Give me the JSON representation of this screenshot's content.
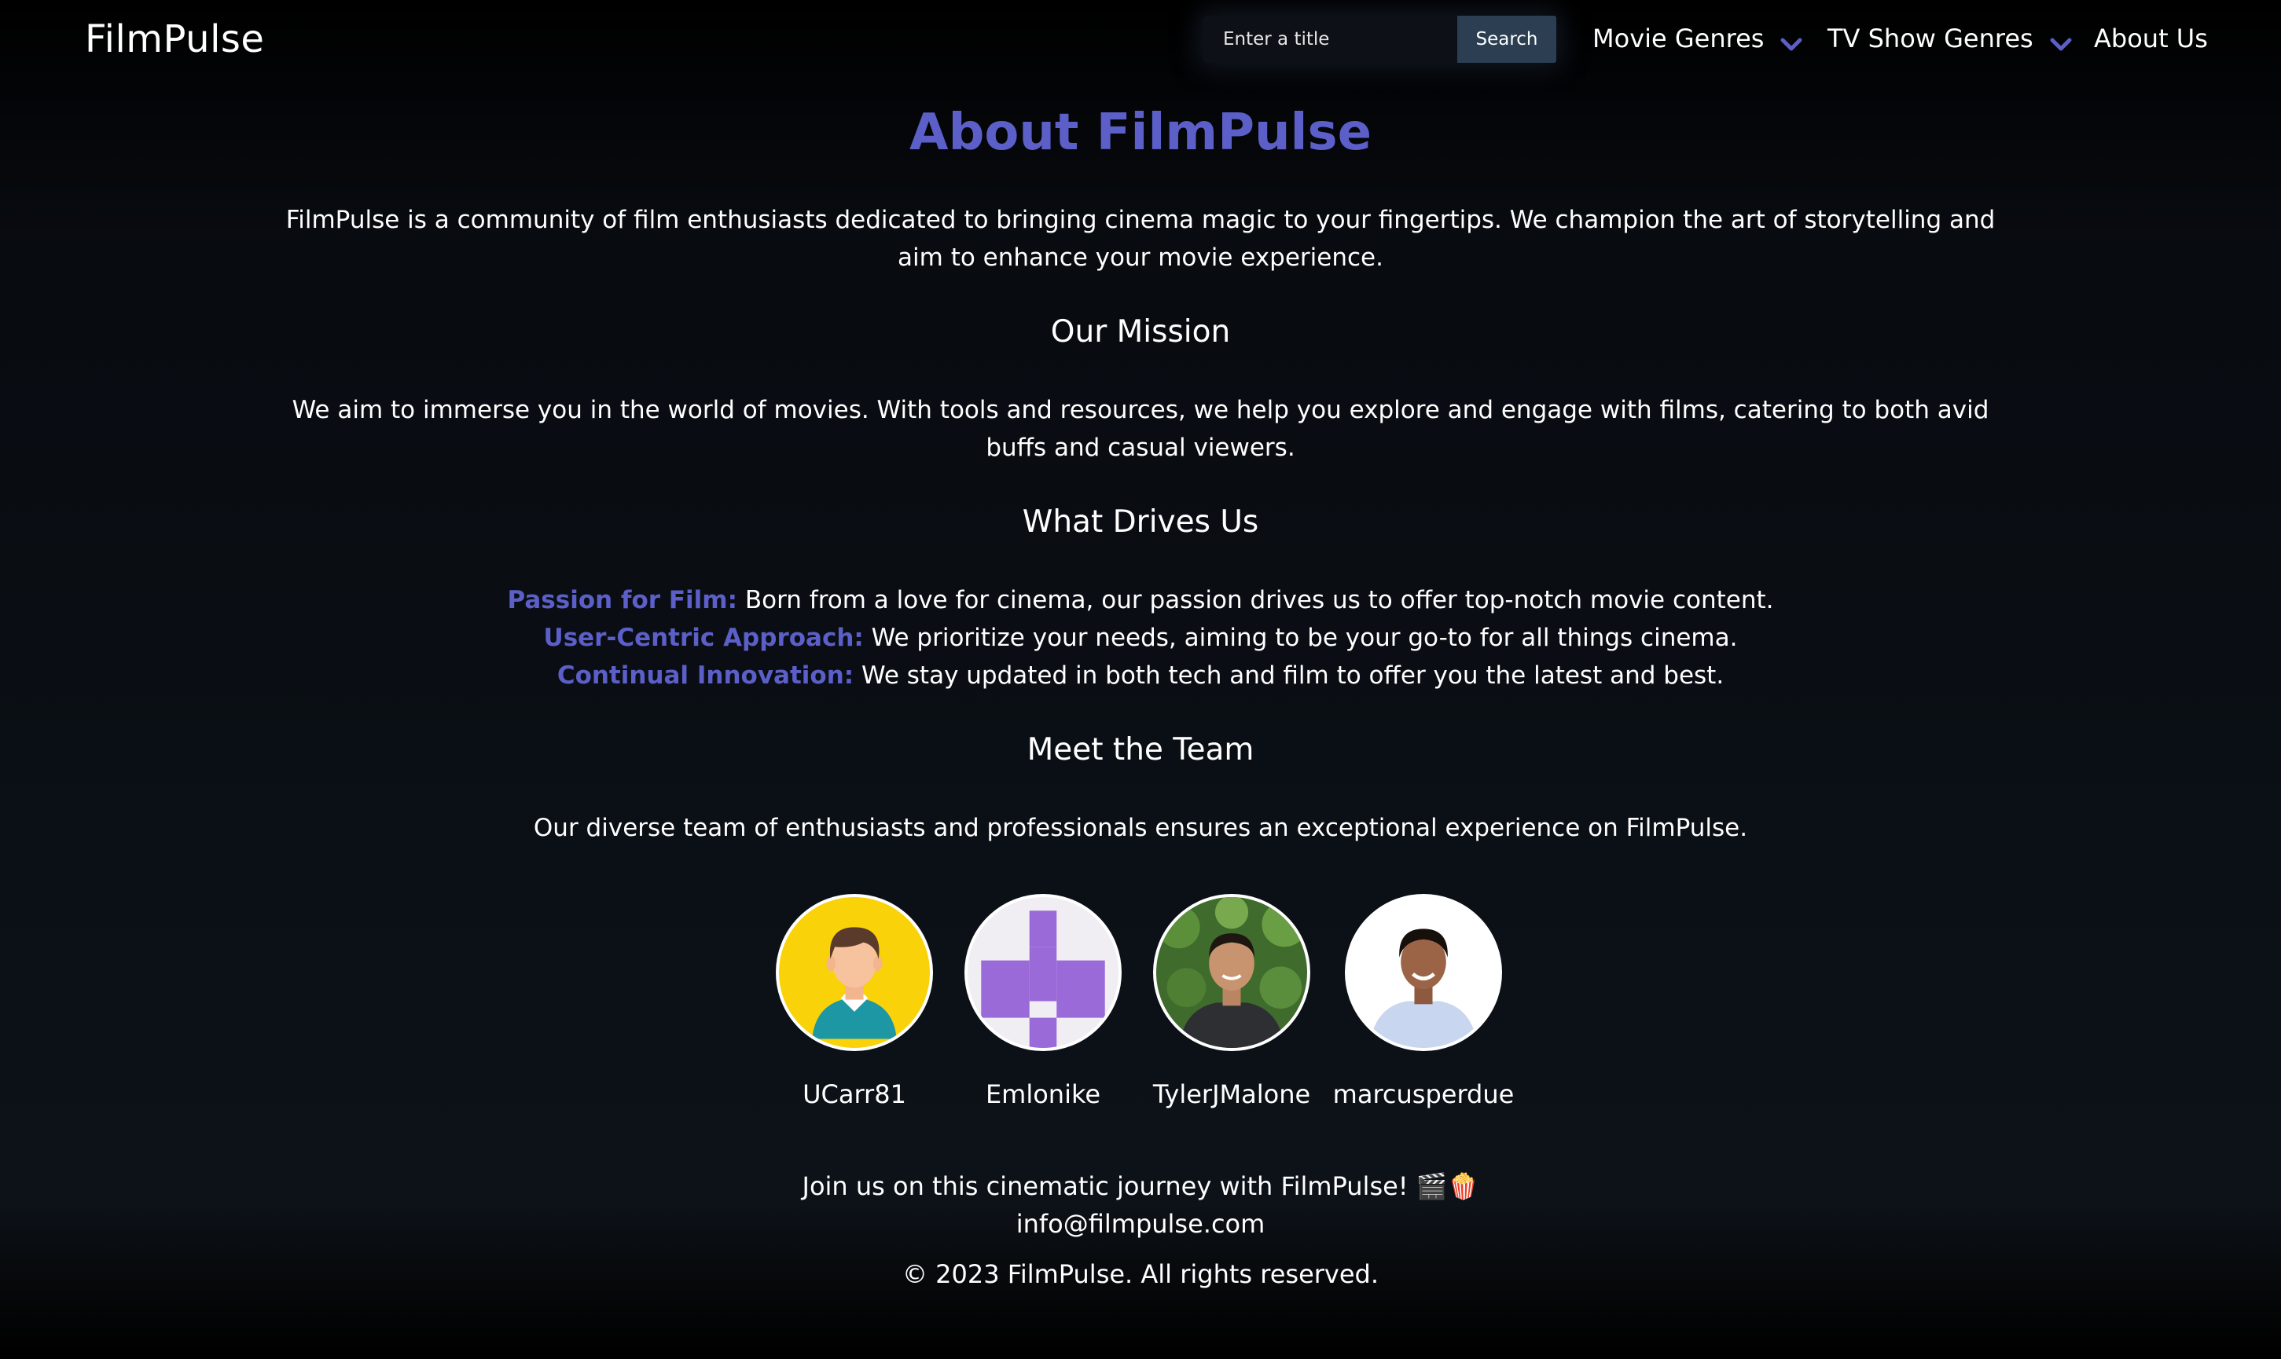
{
  "nav": {
    "brand": "FilmPulse",
    "search_placeholder": "Enter a title",
    "search_button": "Search",
    "movie_genres": "Movie Genres",
    "tv_genres": "TV Show Genres",
    "about": "About Us"
  },
  "colors": {
    "accent": "#5b5fc7",
    "search_button_bg": "#2b3e52"
  },
  "about": {
    "title": "About FilmPulse",
    "intro": "FilmPulse is a community of film enthusiasts dedicated to bringing cinema magic to your fingertips. We champion the art of storytelling and aim to enhance your movie experience.",
    "mission_heading": "Our Mission",
    "mission_text": "We aim to immerse you in the world of movies. With tools and resources, we help you explore and engage with films, catering to both avid buffs and casual viewers.",
    "drives_heading": "What Drives Us",
    "drives": [
      {
        "label": "Passion for Film:",
        "text": " Born from a love for cinema, our passion drives us to offer top-notch movie content."
      },
      {
        "label": "User-Centric Approach:",
        "text": " We prioritize your needs, aiming to be your go-to for all things cinema."
      },
      {
        "label": "Continual Innovation:",
        "text": " We stay updated in both tech and film to offer you the latest and best."
      }
    ],
    "team_heading": "Meet the Team",
    "team_text": "Our diverse team of enthusiasts and professionals ensures an exceptional experience on FilmPulse."
  },
  "team": [
    {
      "name": "UCarr81",
      "avatar": "cartoon-person-avatar"
    },
    {
      "name": "Emlonike",
      "avatar": "purple-cross-identicon-avatar"
    },
    {
      "name": "TylerJMalone",
      "avatar": "photo-avatar"
    },
    {
      "name": "marcusperdue",
      "avatar": "photo-avatar"
    }
  ],
  "footer": {
    "join": "Join us on this cinematic journey with FilmPulse! 🎬🍿",
    "email": "info@filmpulse.com",
    "copyright": "© 2023 FilmPulse. All rights reserved."
  }
}
